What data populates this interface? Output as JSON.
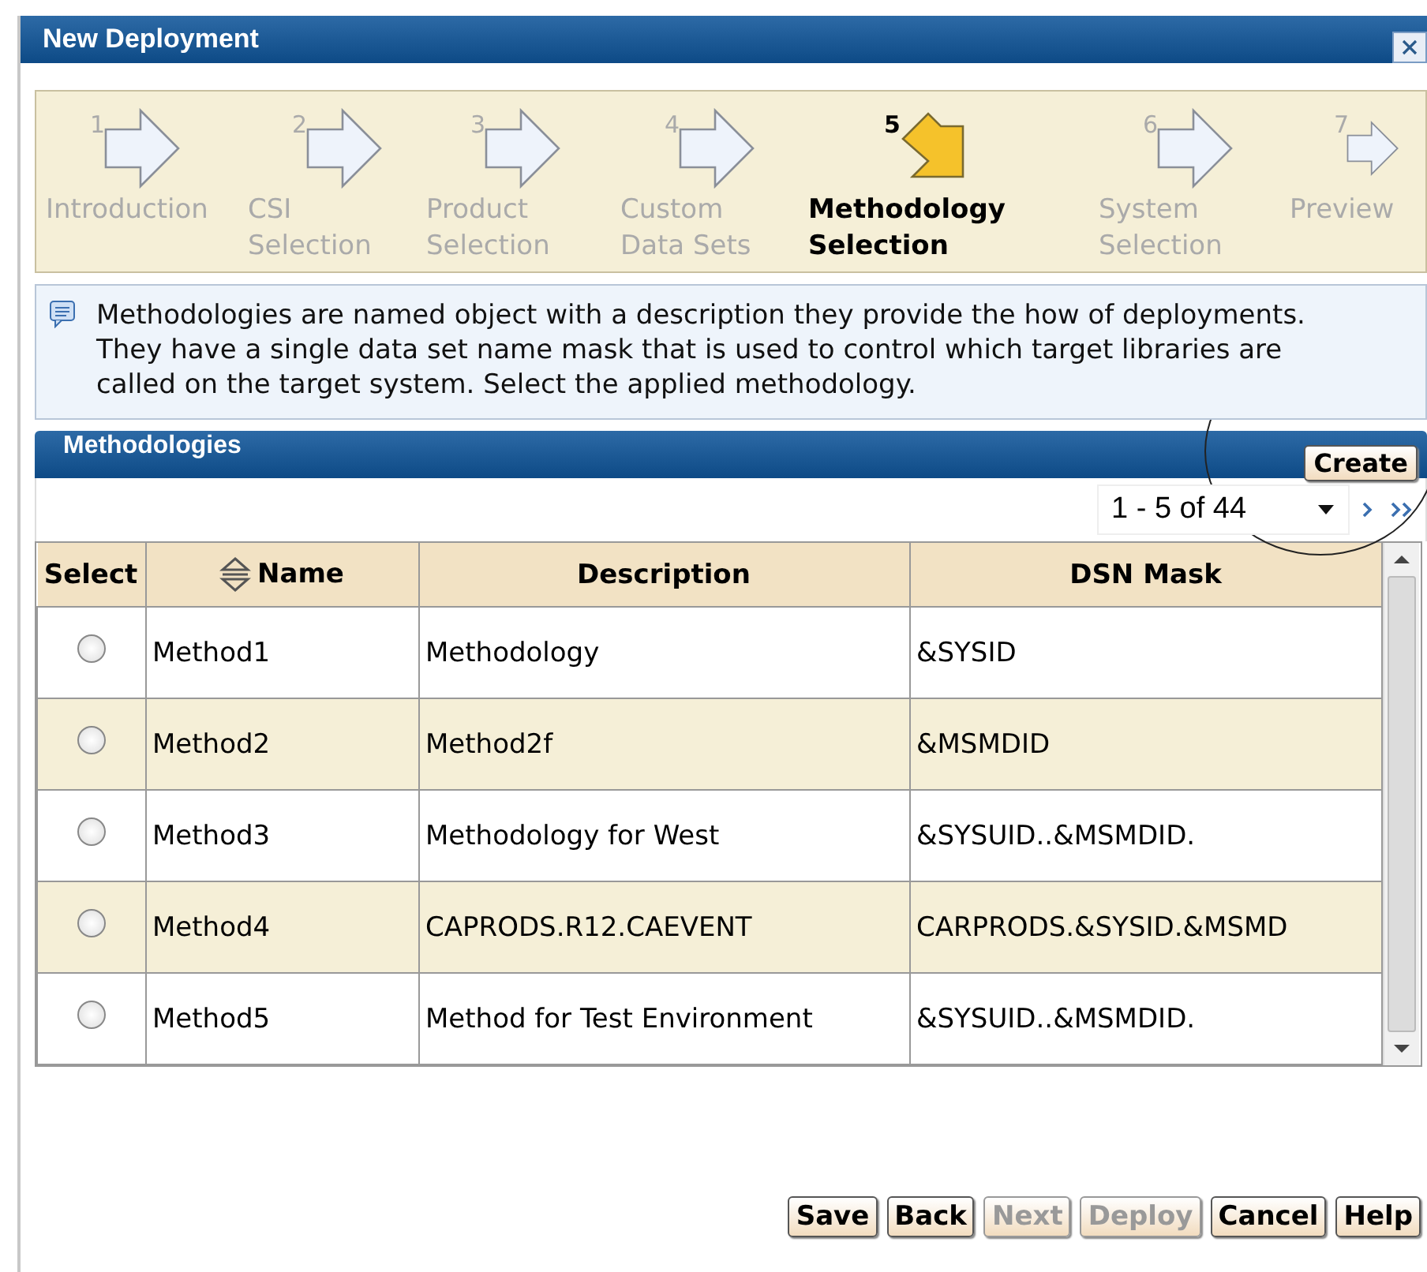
{
  "window": {
    "title": "New Deployment"
  },
  "steps": [
    {
      "number": "1",
      "label": "Introduction",
      "selected": false
    },
    {
      "number": "2",
      "label": "CSI Selection",
      "selected": false
    },
    {
      "number": "3",
      "label": "Product Selection",
      "selected": false
    },
    {
      "number": "4",
      "label": "Custom Data Sets",
      "selected": false
    },
    {
      "number": "5",
      "label": "Methodology Selection",
      "selected": true
    },
    {
      "number": "6",
      "label": "System Selection",
      "selected": false
    },
    {
      "number": "7",
      "label": "Preview",
      "selected": false
    }
  ],
  "info": "Methodologies are named object with a description they provide the how of deployments. They have a single data set name mask that is used to control which target libraries are called on the target system. Select the applied methodology.",
  "panel": {
    "title": "Methodologies",
    "create_button": "Create",
    "pager": "1 - 5 of 44"
  },
  "table": {
    "columns": [
      "Select",
      "Name",
      "Description",
      "DSN Mask"
    ],
    "rows": [
      {
        "selected": false,
        "name": "Method1",
        "description": "Methodology",
        "dsn_mask": "&SYSID"
      },
      {
        "selected": false,
        "name": "Method2",
        "description": "Method2f",
        "dsn_mask": "&MSMDID"
      },
      {
        "selected": false,
        "name": "Method3",
        "description": "Methodology for West",
        "dsn_mask": "&SYSUID..&MSMDID."
      },
      {
        "selected": false,
        "name": "Method4",
        "description": "CAPRODS.R12.CAEVENT",
        "dsn_mask": "CARPRODS.&SYSID.&MSMD"
      },
      {
        "selected": false,
        "name": "Method5",
        "description": "Method for Test Environment",
        "dsn_mask": "&SYSUID..&MSMDID."
      }
    ]
  },
  "buttons": [
    {
      "label": "Save",
      "disabled": false
    },
    {
      "label": "Back",
      "disabled": false
    },
    {
      "label": "Next",
      "disabled": true
    },
    {
      "label": "Deploy",
      "disabled": true
    },
    {
      "label": "Cancel",
      "disabled": false
    },
    {
      "label": "Help",
      "disabled": false
    }
  ]
}
